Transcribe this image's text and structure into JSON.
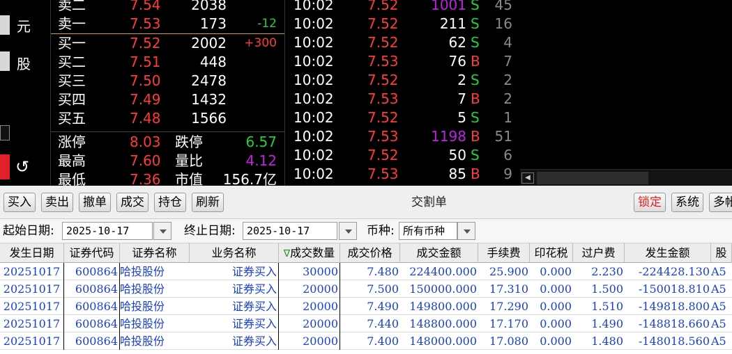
{
  "left_strip": {
    "label_1": "元",
    "label_2": "股",
    "undo_icon": "undo-icon"
  },
  "order_book": {
    "levels": [
      {
        "name": "卖二",
        "price": "7.54",
        "volume": "2038",
        "change": ""
      },
      {
        "name": "卖一",
        "price": "7.53",
        "volume": "173",
        "change": "-12"
      },
      {
        "name": "买一",
        "price": "7.52",
        "volume": "2002",
        "change": "+300"
      },
      {
        "name": "买二",
        "price": "7.51",
        "volume": "448",
        "change": ""
      },
      {
        "name": "买三",
        "price": "7.50",
        "volume": "2478",
        "change": ""
      },
      {
        "name": "买四",
        "price": "7.49",
        "volume": "1432",
        "change": ""
      },
      {
        "name": "买五",
        "price": "7.48",
        "volume": "1566",
        "change": ""
      }
    ],
    "stats": [
      {
        "l1": "涨停",
        "v1": "8.03",
        "l2": "跌停",
        "v2": "6.57",
        "v2_color": "#20d040"
      },
      {
        "l1": "最高",
        "v1": "7.60",
        "l2": "量比",
        "v2": "4.12",
        "v2_color": "#c020e0"
      },
      {
        "l1": "最低",
        "v1": "7.36",
        "l2": "市值",
        "v2": "156.7亿",
        "v2_color": "#ffffff"
      }
    ]
  },
  "ticks": [
    {
      "time": "10:02",
      "price": "7.52",
      "volume": "1001",
      "side": "S",
      "count": "45",
      "big": true
    },
    {
      "time": "10:02",
      "price": "7.52",
      "volume": "211",
      "side": "S",
      "count": "16",
      "big": false
    },
    {
      "time": "10:02",
      "price": "7.52",
      "volume": "62",
      "side": "S",
      "count": "4",
      "big": false
    },
    {
      "time": "10:02",
      "price": "7.53",
      "volume": "76",
      "side": "B",
      "count": "7",
      "big": false
    },
    {
      "time": "10:02",
      "price": "7.52",
      "volume": "2",
      "side": "S",
      "count": "2",
      "big": false
    },
    {
      "time": "10:02",
      "price": "7.53",
      "volume": "7",
      "side": "B",
      "count": "2",
      "big": false
    },
    {
      "time": "10:02",
      "price": "7.52",
      "volume": "5",
      "side": "S",
      "count": "1",
      "big": false
    },
    {
      "time": "10:02",
      "price": "7.53",
      "volume": "1198",
      "side": "B",
      "count": "51",
      "big": true
    },
    {
      "time": "10:02",
      "price": "7.52",
      "volume": "50",
      "side": "S",
      "count": "6",
      "big": false
    },
    {
      "time": "10:02",
      "price": "7.53",
      "volume": "85",
      "side": "B",
      "count": "9",
      "big": false
    }
  ],
  "toolbar": {
    "buttons": [
      "买入",
      "卖出",
      "撤单",
      "成交",
      "持仓",
      "刷新"
    ],
    "title": "交割单",
    "right_buttons": [
      "锁定",
      "系统",
      "多帐"
    ]
  },
  "filter": {
    "start_label": "起始日期:",
    "start_value": "2025-10-17",
    "end_label": "终止日期:",
    "end_value": "2025-10-17",
    "currency_label": "币种:",
    "currency_value": "所有币种"
  },
  "table": {
    "columns": [
      "发生日期",
      "证券代码",
      "证券名称",
      "业务名称",
      "成交数量",
      "成交价格",
      "成交金额",
      "手续费",
      "印花税",
      "过户费",
      "发生金额",
      "股"
    ],
    "rows": [
      [
        "20251017",
        "600864",
        "哈投股份",
        "证券买入",
        "30000",
        "7.480",
        "224400.000",
        "25.900",
        "0.000",
        "2.230",
        "-224428.130",
        "A5"
      ],
      [
        "20251017",
        "600864",
        "哈投股份",
        "证券买入",
        "20000",
        "7.500",
        "150000.000",
        "17.310",
        "0.000",
        "1.500",
        "-150018.810",
        "A5"
      ],
      [
        "20251017",
        "600864",
        "哈投股份",
        "证券买入",
        "20000",
        "7.490",
        "149800.000",
        "17.290",
        "0.000",
        "1.510",
        "-149818.800",
        "A5"
      ],
      [
        "20251017",
        "600864",
        "哈投股份",
        "证券买入",
        "20000",
        "7.440",
        "148800.000",
        "17.170",
        "0.000",
        "1.490",
        "-148818.660",
        "A5"
      ],
      [
        "20251017",
        "600864",
        "哈投股份",
        "证券买入",
        "20000",
        "7.400",
        "148000.000",
        "17.080",
        "0.000",
        "1.480",
        "-148018.560",
        "A5"
      ]
    ]
  },
  "colors": {
    "up": "#ff3a3a",
    "down": "#20d040",
    "big_volume": "#c020e0",
    "grid_text": "#1a3fd4"
  }
}
